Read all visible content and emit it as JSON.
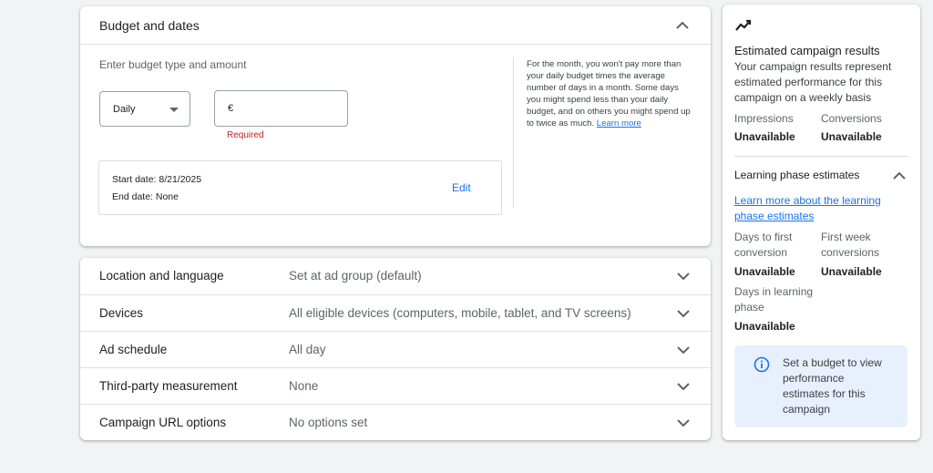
{
  "budget": {
    "title": "Budget and dates",
    "type_label": "Enter budget type and amount",
    "budget_type": "Daily",
    "currency": "€",
    "amount_error": "Required",
    "start_date": "Start date: 8/21/2025",
    "end_date": "End date: None",
    "edit_label": "Edit",
    "help_text": "For the month, you won't pay more than your daily budget times the average number of days in a month. Some days you might spend less than your daily budget, and on others you might spend up to twice as much.",
    "help_link": "Learn more"
  },
  "settings": {
    "rows": [
      {
        "label": "Location and language",
        "value": "Set at ad group (default)"
      },
      {
        "label": "Devices",
        "value": "All eligible devices (computers, mobile, tablet, and TV screens)"
      },
      {
        "label": "Ad schedule",
        "value": "All day"
      },
      {
        "label": "Third-party measurement",
        "value": "None"
      },
      {
        "label": "Campaign URL options",
        "value": "No options set"
      }
    ]
  },
  "results": {
    "icon": "trending-up-icon",
    "title": "Estimated campaign results",
    "description": "Your campaign results represent estimated performance for this campaign on a weekly basis",
    "impressions_label": "Impressions",
    "impressions_value": "Unavailable",
    "conversions_label": "Conversions",
    "conversions_value": "Unavailable",
    "phase_title": "Learning phase estimates",
    "phase_link": "Learn more about the learning phase estimates",
    "days_first_label": "Days to first conversion",
    "days_first_value": "Unavailable",
    "first_week_label": "First week conversions",
    "first_week_value": "Unavailable",
    "days_learning_label": "Days in learning phase",
    "days_learning_value": "Unavailable",
    "notice_icon": "info-icon",
    "notice_text": "Set a budget to view performance estimates for this campaign"
  },
  "colors": {
    "accent": "#1a73e8",
    "error": "#c5221f",
    "notice_bg": "#e8f0fe"
  }
}
